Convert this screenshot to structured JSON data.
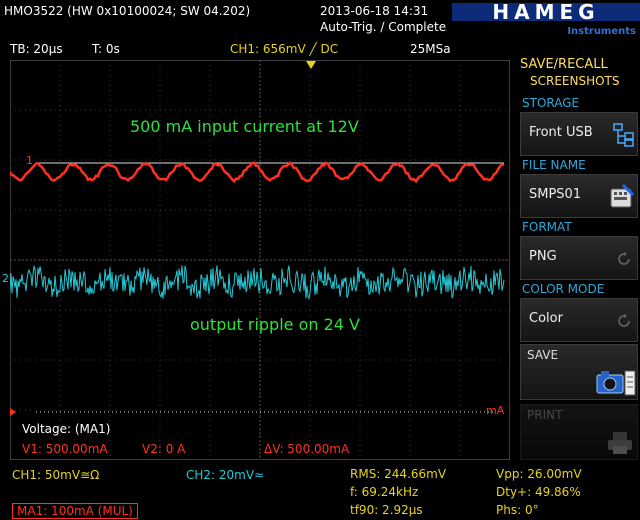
{
  "header": {
    "device": "HMO3522 (HW 0x10100024; SW 04.202)",
    "datetime": "2013-06-18 14:31",
    "trigger_status": "Auto-Trig. / Complete",
    "logo_text": "HAMEG",
    "logo_sub": "Instruments"
  },
  "info": {
    "timebase": "TB: 20µs",
    "trigger_time": "T: 0s",
    "channel_setting": "CH1: 656mV ╱ DC",
    "sample_rate": "25MSa"
  },
  "scope": {
    "annotation_top": "500 mA input current at 12V",
    "annotation_bottom": "output ripple on 24 V",
    "ch1_marker": "1",
    "ch2_marker": "2",
    "ma_marker": "mA",
    "cursor_title": "Voltage: (MA1)",
    "v1": "V1: 500.00mA",
    "v2": "V2: 0 A",
    "dv": "ΔV: 500.00mA",
    "ch1_color": "#ff3020",
    "ch2_color": "#23c9d6"
  },
  "measurements": {
    "ch1": "CH1: 50mV≅Ω",
    "ch2": "CH2: 20mV≈",
    "ma1": "MA1: 100mA (MUL)",
    "rms": "RMS: 244.66mV",
    "freq": "f: 69.24kHz",
    "tf90": "tf90: 2.92µs",
    "vpp": "Vpp: 26.00mV",
    "dty": "Dty+: 49.86%",
    "phs": "Phs: 0°"
  },
  "menu": {
    "title_line1": "SAVE/RECALL",
    "title_line2": "SCREENSHOTS",
    "storage_label": "STORAGE",
    "storage_value": "Front USB",
    "filename_label": "FILE NAME",
    "filename_value": "SMPS01",
    "format_label": "FORMAT",
    "format_value": "PNG",
    "colormode_label": "COLOR MODE",
    "colormode_value": "Color",
    "save_label": "SAVE",
    "print_label": "PRINT"
  }
}
